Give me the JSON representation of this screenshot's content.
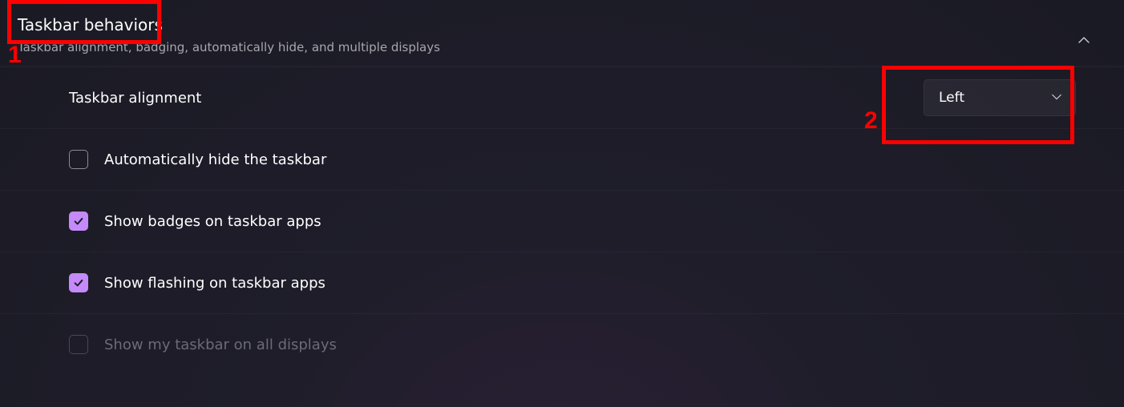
{
  "header": {
    "title": "Taskbar behaviors",
    "subtitle": "Taskbar alignment, badging, automatically hide, and multiple displays"
  },
  "alignment": {
    "label": "Taskbar alignment",
    "selected": "Left"
  },
  "options": {
    "auto_hide": {
      "label": "Automatically hide the taskbar",
      "checked": false,
      "enabled": true
    },
    "badges": {
      "label": "Show badges on taskbar apps",
      "checked": true,
      "enabled": true
    },
    "flashing": {
      "label": "Show flashing on taskbar apps",
      "checked": true,
      "enabled": true
    },
    "all_displays": {
      "label": "Show my taskbar on all displays",
      "checked": false,
      "enabled": false
    }
  },
  "annotations": {
    "one": "1",
    "two": "2"
  },
  "colors": {
    "accent": "#c58af9",
    "highlight": "#ff0000"
  }
}
